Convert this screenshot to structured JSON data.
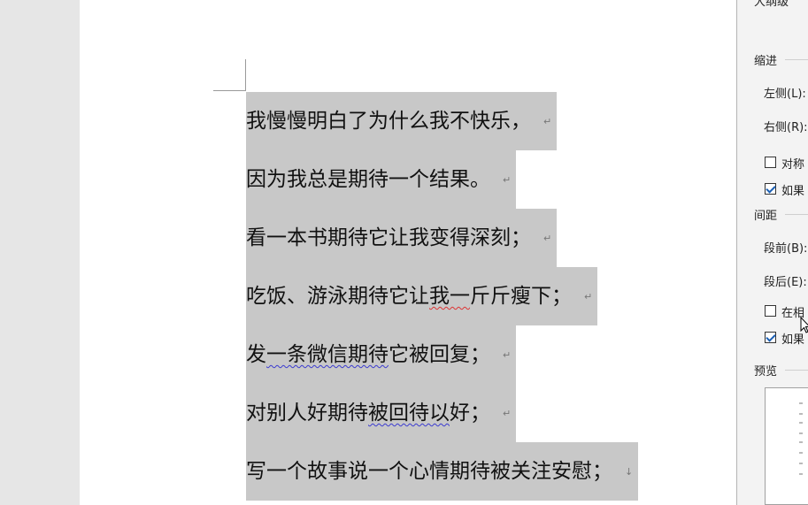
{
  "document": {
    "lines": [
      {
        "text": "我慢慢明白了为什么我不快乐，",
        "mark": "↵"
      },
      {
        "text": "因为我总是期待一个结果。",
        "mark": "↵"
      },
      {
        "text": "看一本书期待它让我变得深刻；",
        "mark": "↵"
      },
      {
        "pre": "吃饭、游泳期待它让",
        "squiggle": "我一",
        "post": "斤斤瘦下；",
        "mark": "↵"
      },
      {
        "pre": "发",
        "squiggle": "一条微信期待",
        "post": "它被回复；",
        "mark": "↵"
      },
      {
        "pre": "对别人好期待",
        "squiggle": "被回待以",
        "post": "好；",
        "mark": "↵"
      },
      {
        "text": "写一个故事说一个心情期待被关注安慰；",
        "mark": "↓"
      }
    ]
  },
  "dialog": {
    "top_cut_label": "大纲级",
    "indent_section": "缩进",
    "left_label": "左侧(L):",
    "right_label": "右侧(R):",
    "mirror_checkbox": "对称",
    "grid_checkbox_1": "如果",
    "spacing_section": "间距",
    "before_label": "段前(B):",
    "after_label": "段后(E):",
    "same_style_checkbox": "在相",
    "grid_checkbox_2": "如果",
    "preview_section": "预览"
  }
}
